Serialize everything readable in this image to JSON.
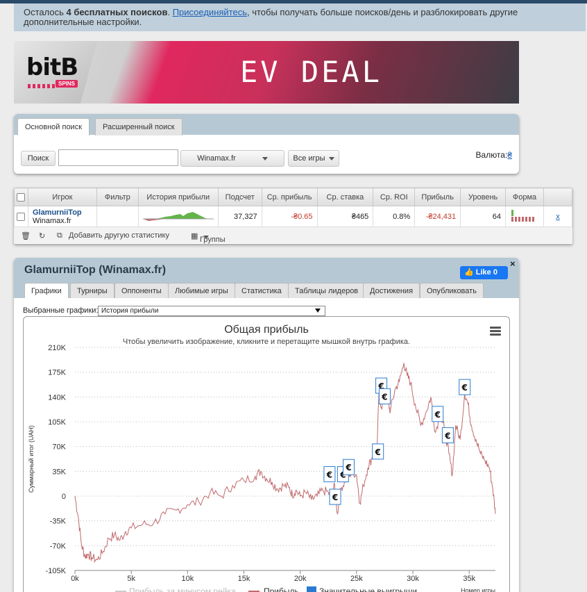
{
  "notice": {
    "prefix": "Осталось ",
    "count": "4 бесплатных поисков",
    "mid": ". ",
    "link": "Присоединяйтесь",
    "rest": ", чтобы получать больше поисков/день и разблокировать другие дополнительные настройки."
  },
  "banner": {
    "logo": "bitB",
    "logo_sub": "SPINS",
    "headline": "EV DEAL"
  },
  "search": {
    "tabs": [
      "Основной поиск",
      "Расширенный поиск"
    ],
    "search_button": "Поиск",
    "search_value": "",
    "site_select": "Winamax.fr",
    "games_select": "Все игры",
    "currency_label": "Валюта:",
    "currency_symbol": "₴"
  },
  "players_table": {
    "columns": [
      "Игрок",
      "Фильтр",
      "История прибыли",
      "Подсчет",
      "Ср. прибыль",
      "Ср. ставка",
      "Ср. ROI",
      "Прибыль",
      "Уровень",
      "Форма"
    ],
    "row": {
      "name": "GlamurniiTop",
      "site": "Winamax.fr",
      "filter": "",
      "count": "37,327",
      "avg_profit": "-₴0.65",
      "avg_stake": "₴465",
      "avg_roi": "0.8%",
      "profit": "-₴24,431",
      "level": "64",
      "remove": "x"
    },
    "footer": {
      "add_stats": "Добавить другую статистику",
      "groups": "Группы"
    }
  },
  "player_panel": {
    "title": "GlamurniiTop (Winamax.fr)",
    "fb_like": "Like 0",
    "close": "×",
    "tabs": [
      "Графики",
      "Турниры",
      "Оппоненты",
      "Любимые игры",
      "Статистика",
      "Таблицы лидеров",
      "Достижения",
      "Опубликовать"
    ],
    "selected_label": "Выбранные графики:",
    "selected_value": "История прибыли"
  },
  "chart_data": {
    "type": "line",
    "title": "Общая прибыль",
    "subtitle": "Чтобы увеличить изображение, кликните и перетащите мышкой внутрь графика.",
    "ylabel": "Суммарный итог (UAH)",
    "xlabel": "Номер игры",
    "ylim": [
      -105000,
      210000
    ],
    "xlim": [
      0,
      37327
    ],
    "y_ticks": [
      "210K",
      "175K",
      "140K",
      "105K",
      "70K",
      "35K",
      "0",
      "-35K",
      "-70K",
      "-105K"
    ],
    "x_ticks": [
      "0k",
      "5k",
      "10k",
      "15k",
      "20k",
      "25k",
      "30k",
      "35k"
    ],
    "grid": true,
    "legend": [
      "Прибыль за минусом рейка",
      "Прибыль",
      "Значительные выигрыши"
    ],
    "colors": {
      "profit": "#c0696c",
      "rake": "#cccccc",
      "markers": "#2a7bd0"
    },
    "series": [
      {
        "name": "Прибыль",
        "x": [
          0,
          300,
          600,
          900,
          1200,
          1500,
          2000,
          2500,
          3000,
          3500,
          4000,
          4500,
          5000,
          6000,
          7000,
          8000,
          9000,
          10000,
          11000,
          12000,
          13000,
          14000,
          15000,
          16000,
          16500,
          17000,
          17500,
          18000,
          18500,
          19000,
          19300,
          19600,
          20000,
          20500,
          21000,
          21500,
          22000,
          22500,
          22800,
          23000,
          23300,
          23600,
          24000,
          24300,
          24600,
          25000,
          25300,
          25600,
          26000,
          26400,
          26800,
          27000,
          27200,
          27500,
          27800,
          28000,
          28400,
          28800,
          29200,
          29500,
          29800,
          30200,
          30700,
          31200,
          31600,
          32000,
          32400,
          32800,
          33200,
          33500,
          33800,
          34200,
          34600,
          34900,
          35200,
          35600,
          36000,
          36400,
          36800,
          37100,
          37327
        ],
        "values": [
          0,
          -30000,
          -70000,
          -85000,
          -82000,
          -87000,
          -90000,
          -78000,
          -60000,
          -55000,
          -62000,
          -50000,
          -45000,
          -40000,
          -38000,
          -25000,
          -20000,
          -12000,
          -8000,
          5000,
          0,
          15000,
          22000,
          28000,
          35000,
          25000,
          20000,
          10000,
          15000,
          12000,
          2000,
          8000,
          0,
          5000,
          -5000,
          0,
          8000,
          5000,
          -5000,
          18000,
          -25000,
          10000,
          22000,
          28000,
          35000,
          30000,
          -10000,
          15000,
          40000,
          55000,
          60000,
          150000,
          125000,
          140000,
          132000,
          120000,
          150000,
          162000,
          188000,
          170000,
          160000,
          130000,
          100000,
          120000,
          140000,
          90000,
          115000,
          95000,
          60000,
          30000,
          100000,
          80000,
          145000,
          130000,
          100000,
          80000,
          60000,
          50000,
          40000,
          10000,
          -25000
        ]
      }
    ],
    "markers": [
      {
        "x": 22600,
        "y": 30000,
        "label": "€"
      },
      {
        "x": 23100,
        "y": -2000,
        "label": "€"
      },
      {
        "x": 23800,
        "y": 30000,
        "label": "€"
      },
      {
        "x": 24300,
        "y": 40000,
        "label": "€"
      },
      {
        "x": 26900,
        "y": 62000,
        "label": "€"
      },
      {
        "x": 27200,
        "y": 155000,
        "label": "€"
      },
      {
        "x": 27500,
        "y": 140000,
        "label": "€"
      },
      {
        "x": 32200,
        "y": 115000,
        "label": "€"
      },
      {
        "x": 33100,
        "y": 85000,
        "label": "€"
      },
      {
        "x": 34600,
        "y": 153000,
        "label": "€"
      }
    ]
  }
}
